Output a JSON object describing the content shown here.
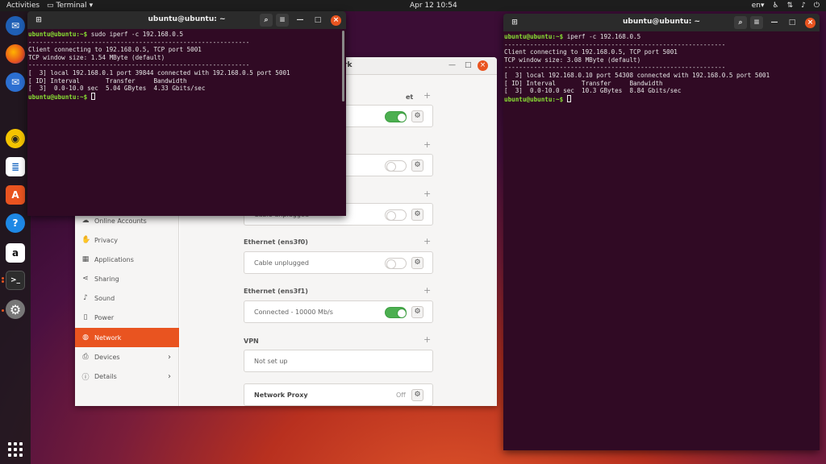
{
  "topbar": {
    "activities": "Activities",
    "app_name": "Terminal",
    "clock": "Apr 12  10:54",
    "keyboard": "en"
  },
  "dock": {
    "items": [
      "thunderbird-icon",
      "firefox-icon",
      "mail-icon",
      "rhythmbox-icon",
      "writer-icon",
      "software-icon",
      "help-icon",
      "amazon-icon",
      "terminal-icon",
      "settings-icon"
    ]
  },
  "settings": {
    "title_partial": "rk",
    "sidebar": [
      {
        "label": "Online Accounts",
        "icon": "cloud"
      },
      {
        "label": "Privacy",
        "icon": "hand"
      },
      {
        "label": "Applications",
        "icon": "grid"
      },
      {
        "label": "Sharing",
        "icon": "share"
      },
      {
        "label": "Sound",
        "icon": "note"
      },
      {
        "label": "Power",
        "icon": "battery"
      },
      {
        "label": "Network",
        "icon": "globe",
        "selected": true
      },
      {
        "label": "Devices",
        "icon": "printer",
        "chevron": true
      },
      {
        "label": "Details",
        "icon": "info",
        "chevron": true
      }
    ],
    "sections": {
      "s1_partial": "et",
      "eth3_label": "Ethernet (ens3f0)",
      "eth3_status": "Cable unplugged",
      "eth4_label": "Ethernet (ens3f1)",
      "eth4_status": "Connected - 10000 Mb/s",
      "vpn_label": "VPN",
      "vpn_status": "Not set up",
      "proxy_label": "Network Proxy",
      "proxy_status": "Off",
      "partial_status": "Cable unplugged"
    }
  },
  "term_left": {
    "title": "ubuntu@ubuntu: ~",
    "prompt": "ubuntu@ubuntu:~$",
    "lines": [
      " sudo iperf -c 192.168.0.5",
      "------------------------------------------------------------",
      "Client connecting to 192.168.0.5, TCP port 5001",
      "TCP window size: 1.54 MByte (default)",
      "------------------------------------------------------------",
      "[  3] local 192.168.0.1 port 39844 connected with 192.168.0.5 port 5001",
      "[ ID] Interval       Transfer     Bandwidth",
      "[  3]  0.0-10.0 sec  5.04 GBytes  4.33 Gbits/sec"
    ]
  },
  "term_right": {
    "title": "ubuntu@ubuntu: ~",
    "prompt": "ubuntu@ubuntu:~$",
    "lines": [
      " iperf -c 192.168.0.5",
      "------------------------------------------------------------",
      "Client connecting to 192.168.0.5, TCP port 5001",
      "TCP window size: 3.08 MByte (default)",
      "------------------------------------------------------------",
      "[  3] local 192.168.0.10 port 54308 connected with 192.168.0.5 port 5001",
      "[ ID] Interval       Transfer     Bandwidth",
      "[  3]  0.0-10.0 sec  10.3 GBytes  8.84 Gbits/sec"
    ]
  }
}
